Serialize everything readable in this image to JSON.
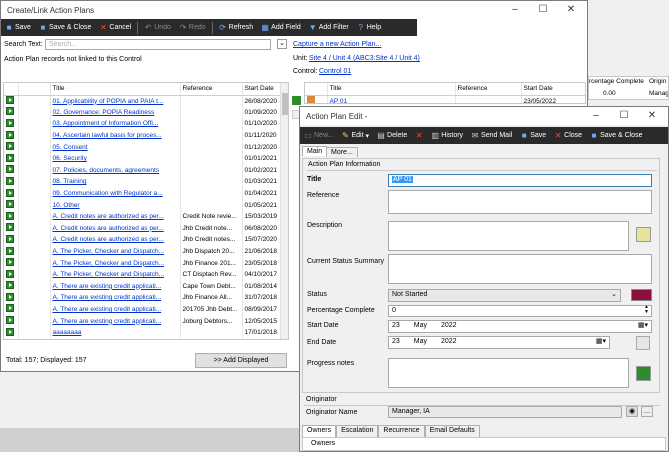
{
  "left_window": {
    "title": "Create/Link Action Plans",
    "toolbar": {
      "save": "Save",
      "save_close": "Save & Close",
      "cancel": "Cancel",
      "undo": "Undo",
      "redo": "Redo",
      "refresh": "Refresh",
      "add_field": "Add Field",
      "add_filter": "Add Filter",
      "help": "Help"
    },
    "search_label": "Search Text:",
    "search_placeholder": "Search...",
    "not_linked_caption": "Action Plan records not linked to this Control",
    "capture_link": "Capture a new Action Plan...",
    "unit_label": "Unit:",
    "unit_link": "Site 4 / Unit 4 (ABC3:Site 4 / Unit 4)",
    "control_label": "Control:",
    "control_link": "Control 01",
    "columns": [
      "Title",
      "Reference",
      "Start Date"
    ],
    "rows": [
      {
        "title": "01. Applicability of POPIA and PAIA t...",
        "ref": "",
        "date": "26/08/2020"
      },
      {
        "title": "02. Governance: POPIA Readiness",
        "ref": "",
        "date": "01/09/2020"
      },
      {
        "title": "03. Appointment of Information Offi...",
        "ref": "",
        "date": "01/10/2020"
      },
      {
        "title": "04. Ascertain lawful basis for proces...",
        "ref": "",
        "date": "01/11/2020"
      },
      {
        "title": "05. Consent",
        "ref": "",
        "date": "01/12/2020"
      },
      {
        "title": "06. Security",
        "ref": "",
        "date": "01/01/2021"
      },
      {
        "title": "07. Policies, documents, agreements",
        "ref": "",
        "date": "01/02/2021"
      },
      {
        "title": "08. Training",
        "ref": "",
        "date": "01/03/2021"
      },
      {
        "title": "09. Communication with Regulator a...",
        "ref": "",
        "date": "01/04/2021"
      },
      {
        "title": "10. Other",
        "ref": "",
        "date": "01/05/2021"
      },
      {
        "title": "A. Credit notes are authorized as per...",
        "ref": "Credit Note revie...",
        "date": "15/03/2019"
      },
      {
        "title": "A. Credit notes are authorized as per...",
        "ref": "Jhb Credit note...",
        "date": "06/08/2020"
      },
      {
        "title": "A. Credit notes are authorized as per...",
        "ref": "Jhb Credit notes...",
        "date": "15/07/2020"
      },
      {
        "title": "A. The Picker, Checker and Dispatch...",
        "ref": "Jhb Dispatch 20...",
        "date": "21/06/2018"
      },
      {
        "title": "A. The Picker, Checker and Dispatch...",
        "ref": "Jhb Finance 201...",
        "date": "23/05/2018"
      },
      {
        "title": "A. The Picker, Checker and Dispatch...",
        "ref": "CT Disptach Rev...",
        "date": "04/10/2017"
      },
      {
        "title": "A. There are existing credit applicati...",
        "ref": "Cape Town Debt...",
        "date": "01/08/2014"
      },
      {
        "title": "A. There are existing credit applicati...",
        "ref": "Jhb Finance All...",
        "date": "31/07/2018"
      },
      {
        "title": "A. There are existing credit applicati...",
        "ref": "201705 Jhb Debt...",
        "date": "08/09/2017"
      },
      {
        "title": "A. There are existing credit applicati...",
        "ref": "Joburg Debtors...",
        "date": "12/05/2015"
      },
      {
        "title": "aaaaaaaa",
        "ref": "",
        "date": "17/01/2018"
      }
    ],
    "status": "Total: 157; Displayed: 157",
    "add_displayed": ">> Add Displayed",
    "linked_columns": [
      "Title",
      "Reference",
      "Start Date"
    ],
    "linked_rows": [
      {
        "title": "AP 01",
        "ref": "",
        "date": "23/05/2022"
      }
    ],
    "far_columns": [
      "rcentage Complete",
      "Origin"
    ],
    "far_row": {
      "pct": "0.00",
      "origin": "Manag"
    }
  },
  "edit_window": {
    "title": "Action Plan Edit -",
    "toolbar": {
      "new": "New...",
      "edit": "Edit",
      "delete": "Delete",
      "history": "History",
      "send_mail": "Send Mail",
      "save": "Save",
      "close": "Close",
      "save_close": "Save & Close"
    },
    "tabs": {
      "main": "Main",
      "more": "More..."
    },
    "section_info": "Action Plan Information",
    "labels": {
      "title": "Title",
      "reference": "Reference",
      "description": "Description",
      "current_status": "Current Status Summary",
      "status": "Status",
      "pct": "Percentage Complete",
      "start": "Start Date",
      "end": "End Date",
      "progress": "Progress notes"
    },
    "values": {
      "title": "AP 01",
      "status": "Not Started",
      "pct": "0",
      "start_day": "23",
      "start_month": "May",
      "start_year": "2022",
      "end_day": "23",
      "end_month": "May",
      "end_year": "2022"
    },
    "status_color": "#8b1040",
    "section_originator": "Originator",
    "originator_label": "Originator Name",
    "originator_value": "Manager, IA",
    "bottom_tabs": [
      "Owners",
      "Escalation",
      "Recurrence",
      "Email Defaults"
    ],
    "owners_header": "Owners"
  }
}
